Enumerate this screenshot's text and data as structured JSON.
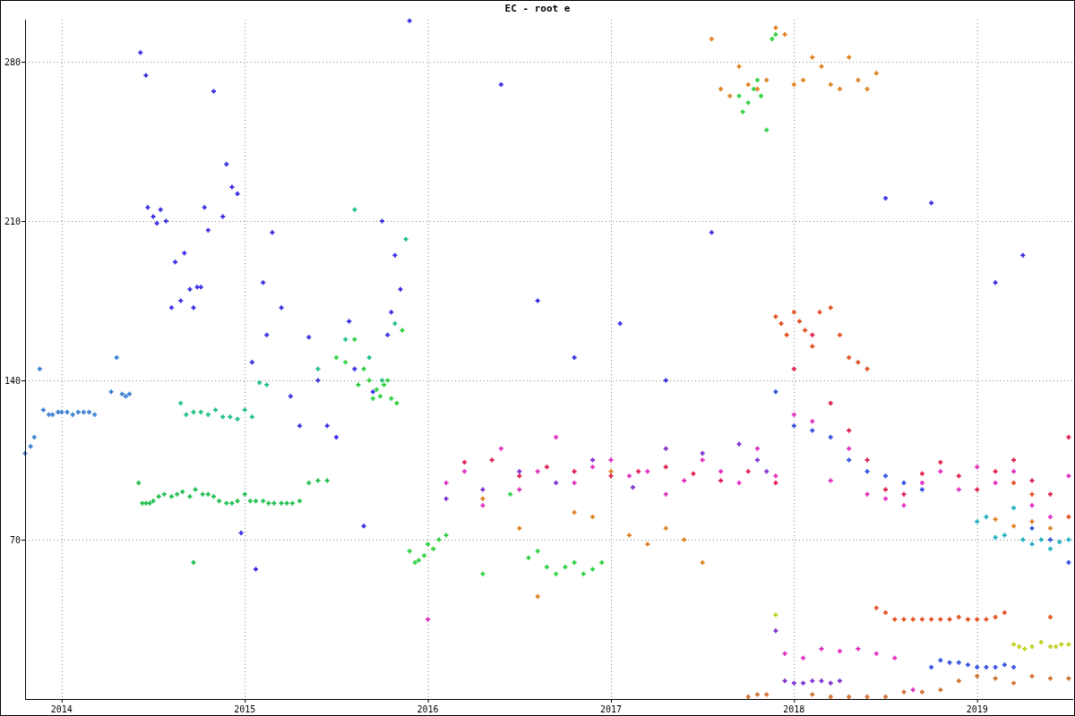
{
  "chart_data": {
    "type": "scatter",
    "title": "EC - root e",
    "grid": true,
    "xlim": [
      2013.8,
      2019.525
    ],
    "ylim": [
      0,
      298.5
    ],
    "xticks": [
      {
        "value": 2014,
        "label": "2014"
      },
      {
        "value": 2015,
        "label": "2015"
      },
      {
        "value": 2016,
        "label": "2016"
      },
      {
        "value": 2017,
        "label": "2017"
      },
      {
        "value": 2018,
        "label": "2018"
      },
      {
        "value": 2019,
        "label": "2019"
      }
    ],
    "yticks": [
      70,
      140,
      210,
      280
    ],
    "series": [
      {
        "color": "#3a7fd0",
        "x": [
          2013.8,
          2013.83,
          2013.85,
          2013.88,
          2013.9,
          2013.93,
          2013.95,
          2013.98,
          2014.0,
          2014.03,
          2014.06,
          2014.09,
          2014.12,
          2014.15,
          2014.18,
          2014.27,
          2014.3,
          2014.33,
          2014.35,
          2014.37
        ],
        "values": [
          108,
          111,
          115,
          145,
          127,
          125,
          125,
          126,
          126,
          126,
          125,
          126,
          126,
          126,
          125,
          135,
          150,
          134,
          133,
          134
        ]
      },
      {
        "color": "#3a2fe0",
        "x": [
          2014.43,
          2014.46,
          2014.47,
          2014.5,
          2014.52,
          2014.54,
          2014.57,
          2014.6,
          2014.62,
          2014.65,
          2014.67,
          2014.7,
          2014.72,
          2014.74,
          2014.76,
          2014.78,
          2014.8,
          2014.83,
          2014.88,
          2014.9,
          2014.93,
          2014.96,
          2014.98,
          2015.04,
          2015.06,
          2015.1,
          2015.12,
          2015.15,
          2015.2,
          2015.25,
          2015.3,
          2015.35,
          2015.4,
          2015.45,
          2015.5,
          2015.57,
          2015.6,
          2015.65,
          2015.7,
          2015.75,
          2015.78,
          2015.8,
          2015.82,
          2015.85,
          2015.9,
          2016.4,
          2016.6,
          2016.8,
          2017.05,
          2017.3,
          2017.55,
          2018.5,
          2018.75,
          2019.1,
          2019.25
        ],
        "values": [
          284,
          274,
          216,
          212,
          209,
          215,
          210,
          172,
          192,
          175,
          196,
          180,
          172,
          181,
          181,
          216,
          206,
          267,
          212,
          235,
          225,
          222,
          73,
          148,
          57,
          183,
          160,
          205,
          172,
          133,
          120,
          159,
          140,
          120,
          115,
          166,
          145,
          76,
          135,
          210,
          160,
          170,
          195,
          180,
          298,
          270,
          175,
          150,
          165,
          140,
          205,
          220,
          218,
          183,
          195
        ]
      },
      {
        "color": "#22c050",
        "x": [
          2014.42,
          2014.44,
          2014.46,
          2014.48,
          2014.5,
          2014.53,
          2014.56,
          2014.6,
          2014.63,
          2014.66,
          2014.7,
          2014.73,
          2014.77,
          2014.8,
          2014.83,
          2014.86,
          2014.9,
          2014.93,
          2014.96,
          2015.0,
          2015.03,
          2015.06,
          2015.1,
          2015.13,
          2015.16,
          2015.2,
          2015.23,
          2015.26,
          2015.3,
          2015.35,
          2015.4,
          2015.45,
          2014.72
        ],
        "values": [
          95,
          86,
          86,
          86,
          87,
          89,
          90,
          89,
          90,
          91,
          89,
          92,
          90,
          90,
          89,
          87,
          86,
          86,
          87,
          90,
          87,
          87,
          87,
          86,
          86,
          86,
          86,
          86,
          87,
          95,
          96,
          96,
          60
        ]
      },
      {
        "color": "#20c080",
        "x": [
          2014.65,
          2014.68,
          2014.72,
          2014.76,
          2014.8,
          2014.84,
          2014.88,
          2014.92,
          2014.96,
          2015.0,
          2015.04,
          2015.08,
          2015.12,
          2015.4,
          2015.55,
          2015.6,
          2015.68,
          2015.75,
          2015.82,
          2015.88
        ],
        "values": [
          130,
          125,
          126,
          126,
          125,
          127,
          124,
          124,
          123,
          127,
          124,
          139,
          138,
          145,
          158,
          215,
          150,
          140,
          165,
          202
        ]
      },
      {
        "color": "#30d040",
        "x": [
          2015.5,
          2015.55,
          2015.6,
          2015.62,
          2015.65,
          2015.68,
          2015.7,
          2015.72,
          2015.74,
          2015.76,
          2015.78,
          2015.8,
          2015.83,
          2015.86,
          2015.9,
          2015.93,
          2015.95,
          2015.98,
          2016.0,
          2016.03,
          2016.06,
          2016.1,
          2016.3,
          2016.45,
          2016.55,
          2016.6,
          2016.65,
          2016.7,
          2016.75,
          2016.8,
          2016.85,
          2016.9,
          2016.95,
          2017.7,
          2017.72,
          2017.75,
          2017.78,
          2017.8,
          2017.82,
          2017.85,
          2017.88,
          2017.9
        ],
        "values": [
          150,
          148,
          158,
          138,
          145,
          140,
          132,
          136,
          133,
          138,
          140,
          132,
          130,
          162,
          65,
          60,
          61,
          63,
          68,
          66,
          70,
          72,
          55,
          90,
          62,
          65,
          58,
          55,
          58,
          60,
          55,
          57,
          60,
          265,
          258,
          262,
          268,
          272,
          265,
          250,
          290,
          292
        ]
      },
      {
        "color": "#e030c0",
        "x": [
          2016.0,
          2016.1,
          2016.2,
          2016.3,
          2016.4,
          2016.5,
          2016.6,
          2016.7,
          2016.8,
          2016.9,
          2017.0,
          2017.1,
          2017.2,
          2017.3,
          2017.4,
          2017.5,
          2017.6,
          2017.7,
          2017.8,
          2017.9,
          2018.0,
          2018.1,
          2018.2,
          2018.3,
          2018.4,
          2018.5,
          2018.6,
          2018.7,
          2018.8,
          2018.9,
          2019.0,
          2019.1,
          2019.2,
          2019.3,
          2019.4,
          2019.5,
          2017.95,
          2018.05,
          2018.15,
          2018.25,
          2018.35,
          2018.45,
          2018.55,
          2018.65
        ],
        "values": [
          35,
          95,
          100,
          85,
          110,
          92,
          100,
          115,
          95,
          102,
          105,
          98,
          100,
          90,
          96,
          105,
          100,
          95,
          110,
          98,
          125,
          122,
          96,
          110,
          90,
          88,
          85,
          95,
          100,
          92,
          102,
          95,
          100,
          85,
          80,
          98,
          20,
          18,
          22,
          21,
          22,
          20,
          18,
          4
        ]
      },
      {
        "color": "#e02050",
        "x": [
          2016.2,
          2016.35,
          2016.5,
          2016.65,
          2016.8,
          2017.0,
          2017.15,
          2017.3,
          2017.45,
          2017.6,
          2017.75,
          2017.9,
          2018.0,
          2018.1,
          2018.2,
          2018.3,
          2018.4,
          2018.5,
          2018.6,
          2018.7,
          2018.8,
          2018.9,
          2019.0,
          2019.1,
          2019.2,
          2019.3,
          2019.4,
          2019.5
        ],
        "values": [
          104,
          105,
          98,
          102,
          100,
          98,
          100,
          102,
          99,
          96,
          100,
          95,
          145,
          160,
          130,
          118,
          105,
          92,
          90,
          99,
          104,
          98,
          92,
          100,
          105,
          96,
          90,
          115
        ]
      },
      {
        "color": "#e08020",
        "x": [
          2016.3,
          2016.5,
          2016.6,
          2016.8,
          2016.9,
          2017.0,
          2017.1,
          2017.2,
          2017.3,
          2017.4,
          2017.5,
          2017.55,
          2017.6,
          2017.65,
          2017.7,
          2017.75,
          2017.8,
          2017.85,
          2017.9,
          2017.95,
          2018.0,
          2018.05,
          2018.1,
          2018.15,
          2018.2,
          2018.25,
          2018.3,
          2018.35,
          2018.4,
          2018.45,
          2019.1,
          2019.2,
          2019.3,
          2019.4
        ],
        "values": [
          88,
          75,
          45,
          82,
          80,
          100,
          72,
          68,
          75,
          70,
          60,
          290,
          268,
          265,
          278,
          270,
          268,
          272,
          295,
          292,
          270,
          272,
          282,
          278,
          270,
          268,
          282,
          272,
          268,
          275,
          79,
          76,
          78,
          75
        ]
      },
      {
        "color": "#e05020",
        "x": [
          2017.9,
          2017.93,
          2017.96,
          2018.0,
          2018.03,
          2018.06,
          2018.1,
          2018.14,
          2018.2,
          2018.25,
          2018.3,
          2018.35,
          2018.4,
          2018.45,
          2018.5,
          2018.55,
          2018.6,
          2018.65,
          2018.7,
          2018.75,
          2018.8,
          2018.85,
          2018.9,
          2018.95,
          2019.0,
          2019.05,
          2019.1,
          2019.15,
          2019.2,
          2019.3,
          2019.4,
          2019.5
        ],
        "values": [
          168,
          165,
          160,
          170,
          166,
          162,
          155,
          170,
          172,
          160,
          150,
          148,
          145,
          40,
          38,
          35,
          35,
          35,
          35,
          35,
          35,
          35,
          36,
          35,
          35,
          35,
          36,
          38,
          95,
          90,
          36,
          80
        ]
      },
      {
        "color": "#8030d0",
        "x": [
          2016.1,
          2016.3,
          2016.5,
          2016.7,
          2016.9,
          2017.12,
          2017.3,
          2017.5,
          2017.7,
          2017.8,
          2017.85,
          2017.9,
          2017.95,
          2018.0,
          2018.05,
          2018.1,
          2018.15,
          2018.2,
          2018.25
        ],
        "values": [
          88,
          92,
          100,
          95,
          105,
          93,
          110,
          108,
          112,
          105,
          100,
          30,
          8,
          7,
          7,
          8,
          8,
          7,
          8
        ]
      },
      {
        "color": "#3050e0",
        "x": [
          2017.9,
          2018.0,
          2018.1,
          2018.2,
          2018.3,
          2018.4,
          2018.5,
          2018.6,
          2018.7,
          2018.75,
          2018.8,
          2018.85,
          2018.9,
          2018.95,
          2019.0,
          2019.05,
          2019.1,
          2019.15,
          2019.2,
          2019.3,
          2019.4,
          2019.5
        ],
        "values": [
          135,
          120,
          118,
          115,
          105,
          100,
          98,
          95,
          92,
          14,
          17,
          16,
          16,
          15,
          14,
          14,
          14,
          15,
          14,
          75,
          70,
          60
        ]
      },
      {
        "color": "#c0d020",
        "x": [
          2017.9,
          2019.2,
          2019.23,
          2019.26,
          2019.3,
          2019.35,
          2019.4,
          2019.43,
          2019.46,
          2019.5
        ],
        "values": [
          37,
          24,
          23,
          22,
          23,
          25,
          23,
          23,
          24,
          24
        ]
      },
      {
        "color": "#20b0c0",
        "x": [
          2019.0,
          2019.05,
          2019.1,
          2019.15,
          2019.2,
          2019.25,
          2019.3,
          2019.35,
          2019.4,
          2019.45,
          2019.5
        ],
        "values": [
          78,
          80,
          71,
          72,
          84,
          70,
          68,
          70,
          66,
          69,
          70
        ]
      },
      {
        "color": "#d07030",
        "x": [
          2017.75,
          2017.8,
          2017.85,
          2018.1,
          2018.2,
          2018.3,
          2018.4,
          2018.5,
          2018.6,
          2018.7,
          2018.8,
          2018.9,
          2019.0,
          2019.1,
          2019.2,
          2019.3,
          2019.4,
          2019.5
        ],
        "values": [
          1,
          2,
          2,
          2,
          1,
          1,
          1,
          1,
          3,
          3,
          4,
          8,
          10,
          9,
          7,
          10,
          9,
          9
        ]
      }
    ]
  }
}
